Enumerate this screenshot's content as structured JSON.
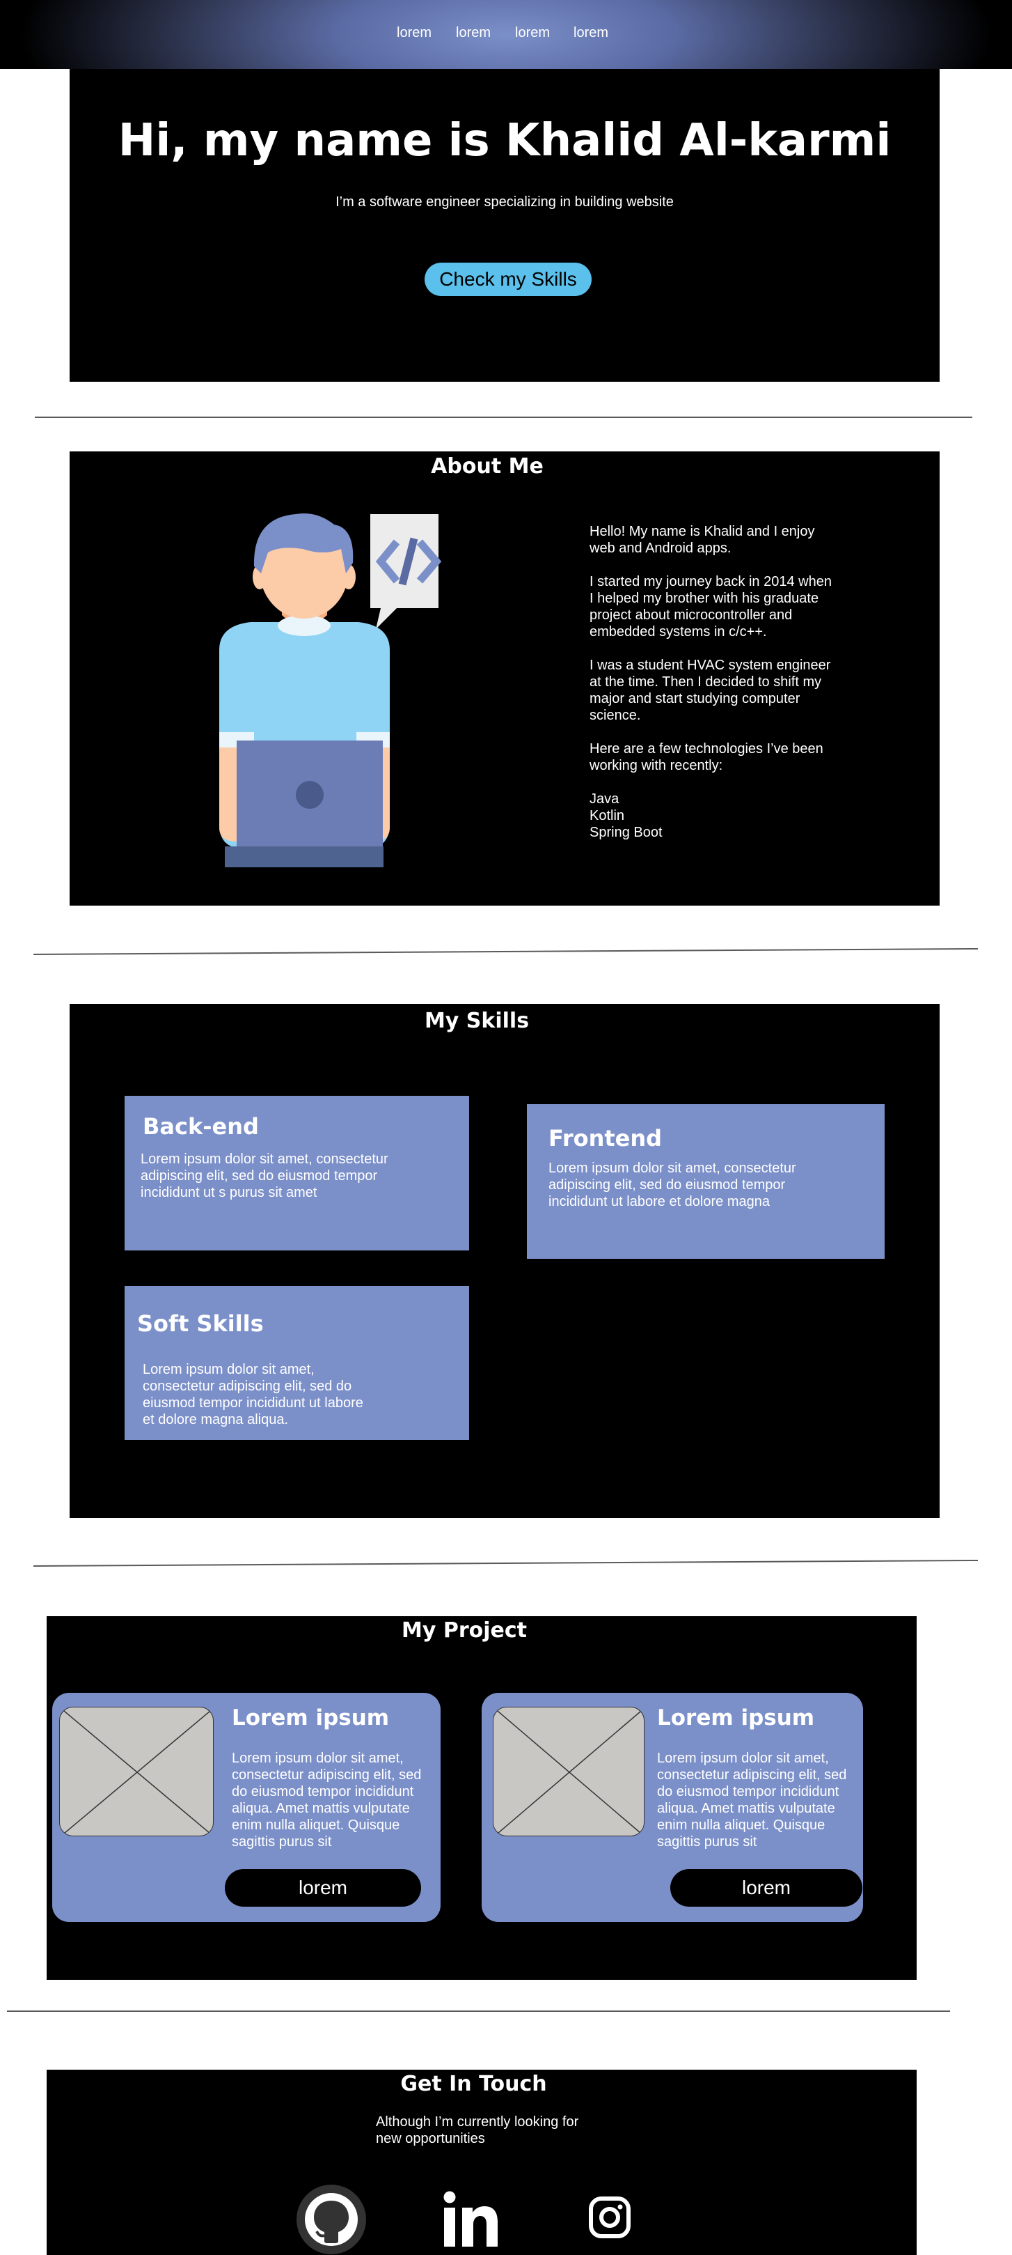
{
  "nav": {
    "links": [
      "lorem",
      "lorem",
      "lorem",
      "lorem"
    ]
  },
  "hero": {
    "title": "Hi, my name is Khalid Al-karmi",
    "subtitle": "I’m a software engineer specializing in building website",
    "cta": "Check my Skills"
  },
  "about": {
    "title": "About Me",
    "paragraphs": [
      "Hello! My name is Khalid and I enjoy web and Android apps.",
      "I started my journey back in 2014 when I helped my brother with his graduate project about microcontroller and embedded systems in c/c++.",
      "I was a student HVAC system engineer at the time. Then I decided to shift my major and start studying computer science.",
      "Here are a few technologies I’ve been working with recently:"
    ],
    "technologies": [
      "Java",
      "Kotlin",
      "Spring Boot"
    ],
    "illustration_icon": "developer-illustration",
    "code_bubble_text": "</>"
  },
  "skills": {
    "title": "My Skills",
    "cards": [
      {
        "title": "Back-end",
        "text": "Lorem ipsum dolor sit amet, consectetur adipiscing elit, sed do eiusmod tempor incididunt ut s purus sit amet"
      },
      {
        "title": "Frontend",
        "text": "Lorem ipsum dolor sit amet, consectetur adipiscing elit, sed do eiusmod tempor incididunt ut labore et dolore magna"
      },
      {
        "title": "Soft Skills",
        "text": "Lorem ipsum dolor sit amet, consectetur adipiscing elit, sed do eiusmod tempor incididunt ut labore et dolore magna aliqua."
      }
    ]
  },
  "projects": {
    "title": "My Project",
    "cards": [
      {
        "title": "Lorem ipsum",
        "text": "Lorem ipsum dolor sit amet, consectetur adipiscing elit, sed do eiusmod tempor incididunt aliqua. Amet mattis vulputate enim nulla aliquet. Quisque sagittis purus sit",
        "button": "lorem"
      },
      {
        "title": "Lorem ipsum",
        "text": "Lorem ipsum dolor sit amet, consectetur adipiscing elit, sed do eiusmod tempor incididunt aliqua. Amet mattis vulputate enim nulla aliquet. Quisque sagittis purus sit",
        "button": "lorem"
      }
    ]
  },
  "contact": {
    "title": "Get In Touch",
    "text": "Although I’m currently looking for new opportunities",
    "socials": [
      "github-icon",
      "linkedin-icon",
      "instagram-icon"
    ]
  },
  "colors": {
    "accent": "#7b8fc9",
    "cta": "#5bc0eb",
    "panel": "#000000"
  }
}
